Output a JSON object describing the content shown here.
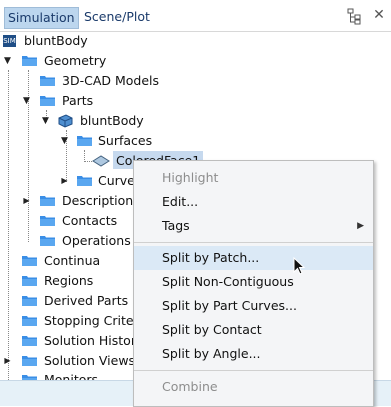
{
  "tabs": [
    "Simulation",
    "Scene/Plot"
  ],
  "icons": {
    "tree_toggle": "tree-view-icon",
    "close": "close-icon",
    "root": "simulation-icon",
    "part": "part-icon",
    "surface": "surface-icon",
    "folder": "folder-icon"
  },
  "colors": {
    "folder": "#3a8ee6",
    "selection": "#c6d9ee",
    "menu_hover": "#dbe9f6",
    "tab_active": "#bcd6ee"
  },
  "tree": {
    "root": "bluntBody",
    "geometry": "Geometry",
    "cad_models": "3D-CAD Models",
    "parts": "Parts",
    "part_body": "bluntBody",
    "surfaces": "Surfaces",
    "colored_face": "ColoredFace1",
    "curves": "Curves",
    "descriptions": "Descriptions",
    "contacts": "Contacts",
    "operations": "Operations",
    "continua": "Continua",
    "regions": "Regions",
    "derived_parts": "Derived Parts",
    "stopping_criteria": "Stopping Criteria",
    "solution_histories": "Solution Histories",
    "solution_views": "Solution Views",
    "monitors": "Monitors"
  },
  "menu": {
    "highlight": "Highlight",
    "edit": "Edit...",
    "tags": "Tags",
    "split_by_patch": "Split by Patch...",
    "split_non_contiguous": "Split Non-Contiguous",
    "split_by_part_curves": "Split by Part Curves...",
    "split_by_contact": "Split by Contact",
    "split_by_angle": "Split by Angle...",
    "combine": "Combine"
  }
}
